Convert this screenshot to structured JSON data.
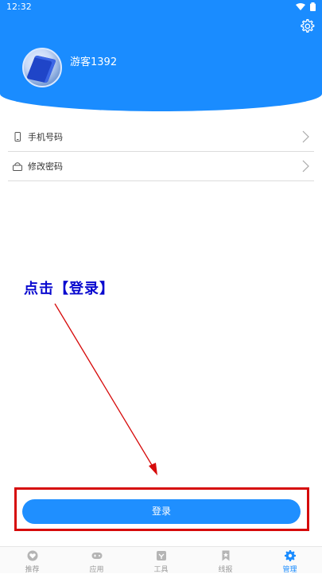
{
  "status_bar": {
    "time": "12:32"
  },
  "header": {
    "username": "游客1392"
  },
  "menu": {
    "items": [
      {
        "label": "手机号码",
        "icon": "phone-icon"
      },
      {
        "label": "修改密码",
        "icon": "lock-icon"
      }
    ]
  },
  "annotation": {
    "text": "点击【登录】"
  },
  "login": {
    "label": "登录"
  },
  "bottom_nav": {
    "items": [
      {
        "label": "推荐",
        "icon": "heart-icon"
      },
      {
        "label": "应用",
        "icon": "gamepad-icon"
      },
      {
        "label": "工具",
        "icon": "tools-icon"
      },
      {
        "label": "线报",
        "icon": "bookmark-icon"
      },
      {
        "label": "管理",
        "icon": "gear-icon",
        "active": true
      }
    ]
  },
  "colors": {
    "primary": "#1a8cff",
    "annotation_red": "#d60b0b",
    "annotation_blue": "#0a0acf"
  }
}
